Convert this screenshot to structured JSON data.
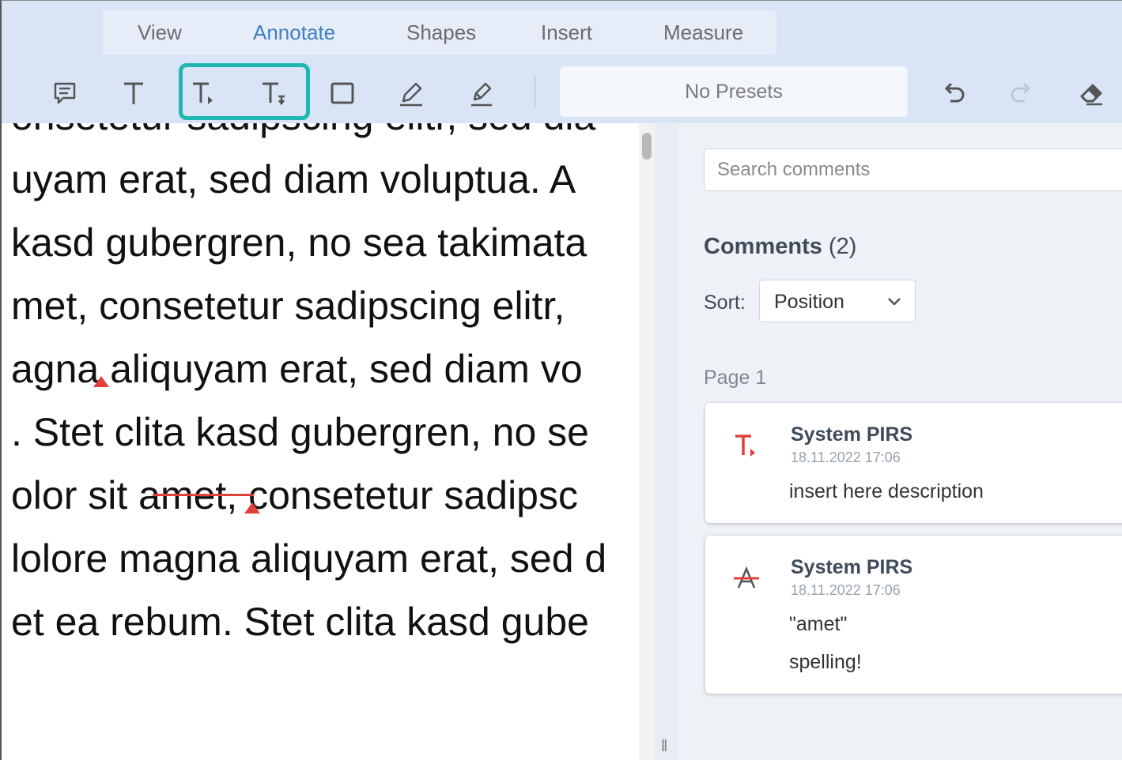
{
  "tabs": [
    {
      "label": "View",
      "active": false
    },
    {
      "label": "Annotate",
      "active": true
    },
    {
      "label": "Shapes",
      "active": false
    },
    {
      "label": "Insert",
      "active": false
    },
    {
      "label": "Measure",
      "active": false
    }
  ],
  "toolbar": {
    "tools": [
      "comment-icon",
      "text-icon",
      "insert-text-icon",
      "replace-text-icon",
      "rectangle-icon",
      "pen-icon",
      "highlighter-icon"
    ],
    "presets_label": "No Presets",
    "actions": [
      "undo-icon",
      "redo-icon",
      "eraser-icon"
    ]
  },
  "document": {
    "lines": [
      "onsetetur sadipscing elitr, sed dia",
      "uyam erat, sed diam voluptua. A",
      " kasd gubergren, no sea takimata",
      "met, consetetur sadipscing elitr,",
      "agna aliquyam erat, sed diam vo",
      ". Stet clita kasd gubergren, no se",
      "olor sit amet, consetetur sadipsc",
      "lolore magna aliquyam erat, sed d",
      "et ea rebum. Stet clita kasd gube"
    ]
  },
  "panel": {
    "search_placeholder": "Search comments",
    "comments_label": "Comments",
    "comments_count": "(2)",
    "sort_label": "Sort:",
    "sort_value": "Position",
    "page_label": "Page 1",
    "comments": [
      {
        "icon": "insert-text-icon",
        "author": "System PIRS",
        "date": "18.11.2022 17:06",
        "text": [
          "insert here description"
        ]
      },
      {
        "icon": "strikeout-icon",
        "author": "System PIRS",
        "date": "18.11.2022 17:06",
        "text": [
          "\"amet\"",
          "spelling!"
        ]
      }
    ]
  },
  "colors": {
    "accent": "#3d7fc1",
    "highlight_box": "#1eb8b0",
    "annotation_red": "#e0413a",
    "header_bg": "#d9e5f6"
  }
}
